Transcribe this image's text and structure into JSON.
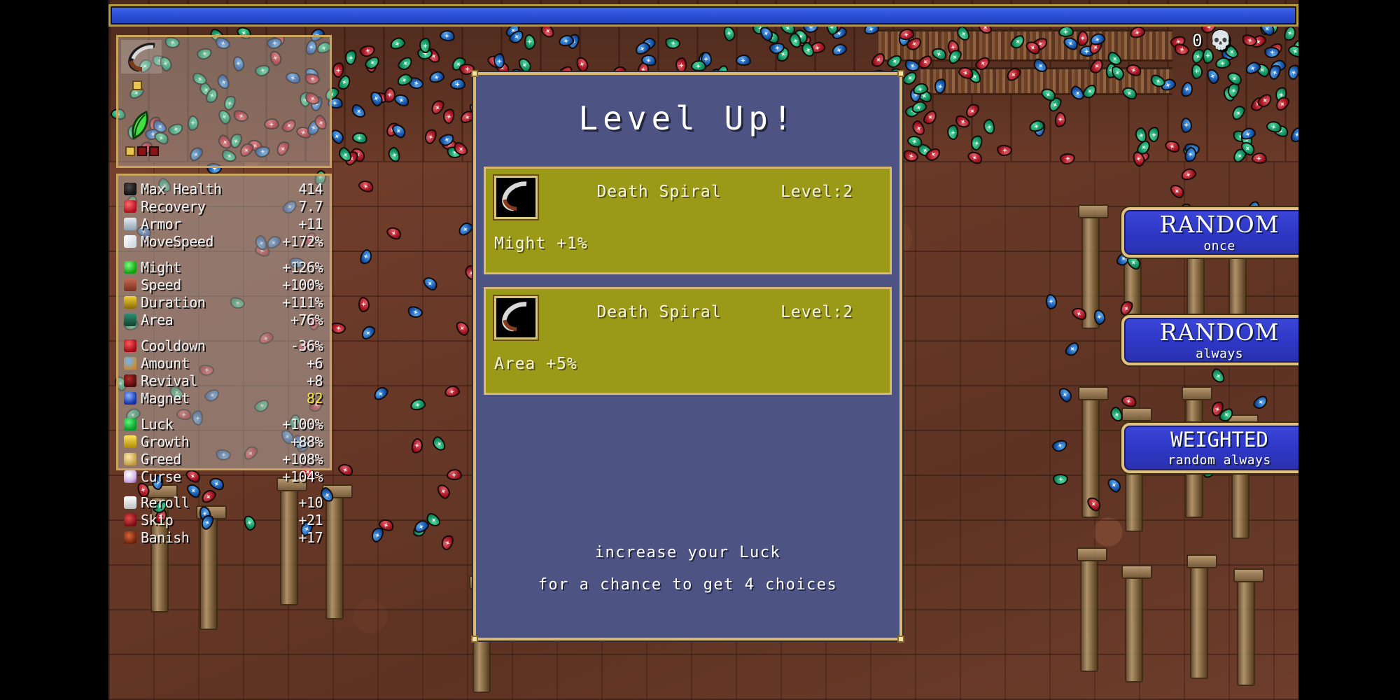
{
  "hud": {
    "xp_bar": {
      "name": "experience-bar",
      "fill_percent": 100,
      "color": "#2b4ed6"
    },
    "kill_count": "0",
    "skull_icon": "skull-icon",
    "clock_value": "0/"
  },
  "character_panel": {
    "weapon_icon": "scythe-icon",
    "passive_icon": "leaf-icon"
  },
  "stats": {
    "title": "player-stats",
    "groups": [
      {
        "rows": [
          {
            "icon": "black-heart-icon",
            "label": "Max Health",
            "value": "414",
            "highlight": false
          },
          {
            "icon": "red-heart-icon",
            "label": "Recovery",
            "value": "7.7",
            "highlight": false
          },
          {
            "icon": "armor-icon",
            "label": "Armor",
            "value": "+11",
            "highlight": false
          },
          {
            "icon": "wing-icon",
            "label": "MoveSpeed",
            "value": "+172%",
            "highlight": false
          }
        ]
      },
      {
        "rows": [
          {
            "icon": "green-gem-icon",
            "label": "Might",
            "value": "+126%",
            "highlight": false
          },
          {
            "icon": "glove-icon",
            "label": "Speed",
            "value": "+100%",
            "highlight": false
          },
          {
            "icon": "hourglass-icon",
            "label": "Duration",
            "value": "+111%",
            "highlight": false
          },
          {
            "icon": "crown-icon",
            "label": "Area",
            "value": "+76%",
            "highlight": false
          }
        ]
      },
      {
        "rows": [
          {
            "icon": "stopwatch-icon",
            "label": "Cooldown",
            "value": "-36%",
            "highlight": false
          },
          {
            "icon": "orb-icon",
            "label": "Amount",
            "value": "+6",
            "highlight": false
          },
          {
            "icon": "revival-icon",
            "label": "Revival",
            "value": "+8",
            "highlight": false
          },
          {
            "icon": "magnet-icon",
            "label": "Magnet",
            "value": "82",
            "highlight": true
          }
        ]
      },
      {
        "rows": [
          {
            "icon": "clover-icon",
            "label": "Luck",
            "value": "+100%",
            "highlight": false
          },
          {
            "icon": "gold-crown-icon",
            "label": "Growth",
            "value": "+88%",
            "highlight": false
          },
          {
            "icon": "coin-icon",
            "label": "Greed",
            "value": "+108%",
            "highlight": false
          },
          {
            "icon": "skull-icon",
            "label": "Curse",
            "value": "+104%",
            "highlight": false
          }
        ]
      },
      {
        "rows": [
          {
            "icon": "dice-icon",
            "label": "Reroll",
            "value": "+10",
            "highlight": false
          },
          {
            "icon": "skip-icon",
            "label": "Skip",
            "value": "+21",
            "highlight": false
          },
          {
            "icon": "banish-icon",
            "label": "Banish",
            "value": "+17",
            "highlight": false
          }
        ]
      }
    ]
  },
  "levelup": {
    "title": "Level Up!",
    "choices": [
      {
        "icon": "scythe-icon",
        "name": "Death Spiral",
        "level": "Level:2",
        "description": "Might +1%"
      },
      {
        "icon": "scythe-icon",
        "name": "Death Spiral",
        "level": "Level:2",
        "description": "Area +5%"
      }
    ],
    "hint_line_1": "increase your Luck",
    "hint_line_2": "for a chance to get 4 choices"
  },
  "side_buttons": [
    {
      "main": "RANDOM",
      "sub": "once",
      "style": "serif"
    },
    {
      "main": "RANDOM",
      "sub": "always",
      "style": "serif"
    },
    {
      "main": "WEIGHTED",
      "sub": "random always",
      "style": "mono"
    }
  ],
  "colors": {
    "panel_body": "#4d5383",
    "panel_border": "#d9b871",
    "card_body": "#9a9a18",
    "button_blue": "#2e37c4",
    "xp_blue": "#2b4ed6",
    "highlight_yellow": "#f2e43a",
    "ground_brown": "#6b3a28"
  }
}
